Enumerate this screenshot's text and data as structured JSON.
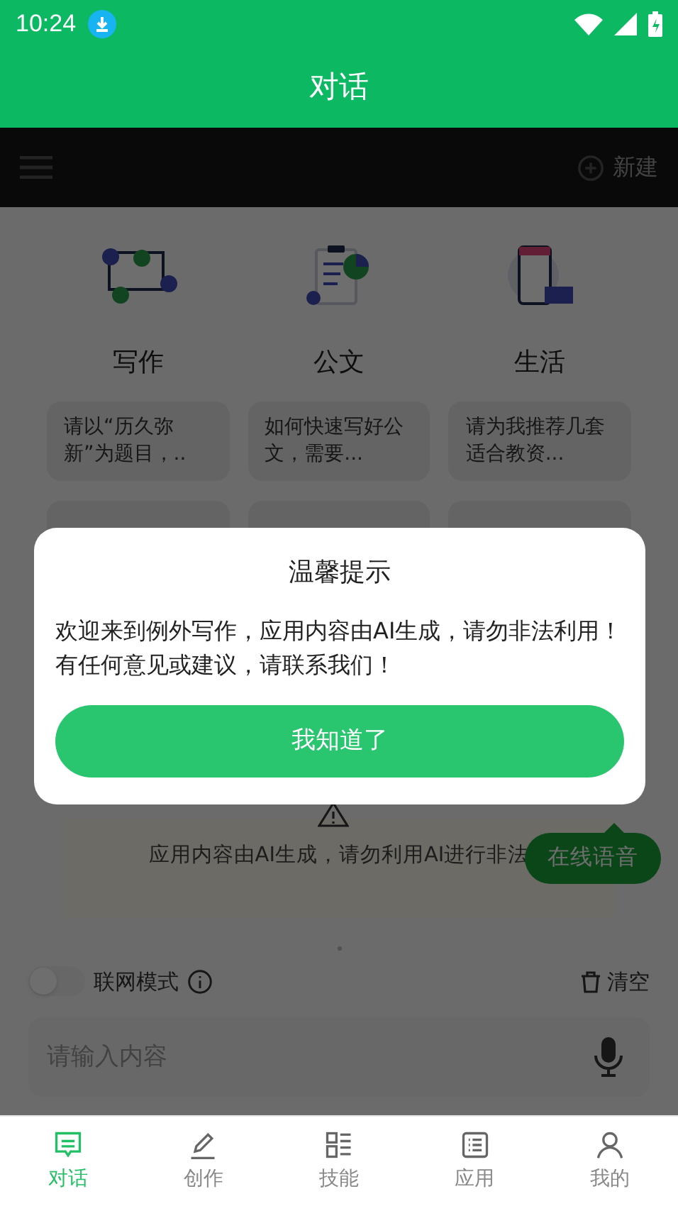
{
  "status_bar": {
    "time": "10:24"
  },
  "title_bar": {
    "title": "对话"
  },
  "toolbar": {
    "new_label": "新建"
  },
  "categories": [
    {
      "kind": "writing",
      "title": "写作",
      "prompts": [
        "请以“历久弥新”为题目，.."
      ]
    },
    {
      "kind": "document",
      "title": "公文",
      "prompts": [
        "如何快速写好公文，需要..."
      ]
    },
    {
      "kind": "life",
      "title": "生活",
      "prompts": [
        "请为我推荐几套适合教资..."
      ]
    }
  ],
  "notice": {
    "text": "应用内容由AI生成，请勿利用AI进行非法"
  },
  "voice_bubble": "在线语音",
  "controls": {
    "network_mode": {
      "label": "联网模式",
      "on": false
    },
    "clear_label": "清空"
  },
  "input": {
    "placeholder": "请输入内容"
  },
  "dialog": {
    "title": "温馨提示",
    "message": "欢迎来到例外写作，应用内容由AI生成，请勿非法利用！有任何意见或建议，请联系我们！",
    "button": "我知道了"
  },
  "nav": [
    {
      "kind": "chat",
      "label": "对话",
      "selected": true
    },
    {
      "kind": "create",
      "label": "创作",
      "selected": false
    },
    {
      "kind": "skills",
      "label": "技能",
      "selected": false
    },
    {
      "kind": "apps",
      "label": "应用",
      "selected": false
    },
    {
      "kind": "profile",
      "label": "我的",
      "selected": false
    }
  ]
}
